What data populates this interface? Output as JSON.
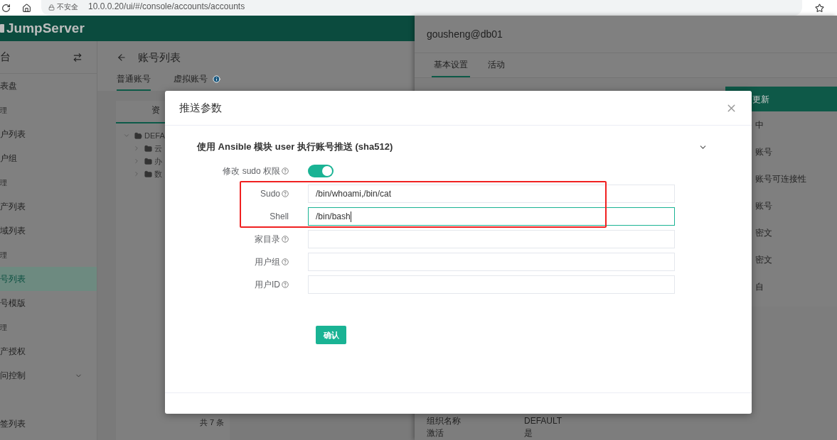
{
  "browser": {
    "security_label": "不安全",
    "url": "10.0.0.20/ui/#/console/accounts/accounts"
  },
  "header": {
    "logo": "JumpServer"
  },
  "sidebar": {
    "title": "台",
    "items": [
      {
        "label": "表盘",
        "kind": "item",
        "selected": false
      },
      {
        "label": "理",
        "kind": "group"
      },
      {
        "label": "户列表",
        "kind": "item",
        "selected": false
      },
      {
        "label": "户组",
        "kind": "item",
        "selected": false
      },
      {
        "label": "理",
        "kind": "group"
      },
      {
        "label": "产列表",
        "kind": "item",
        "selected": false
      },
      {
        "label": "域列表",
        "kind": "item",
        "selected": false
      },
      {
        "label": "理",
        "kind": "group"
      },
      {
        "label": "号列表",
        "kind": "item",
        "selected": true
      },
      {
        "label": "号模版",
        "kind": "item",
        "selected": false
      },
      {
        "label": "理",
        "kind": "group"
      },
      {
        "label": "产授权",
        "kind": "item",
        "selected": false
      },
      {
        "label": "问控制",
        "kind": "submenu",
        "selected": false,
        "expanded": false
      },
      {
        "label": "签列表",
        "kind": "item",
        "selected": false
      }
    ]
  },
  "page": {
    "title": "账号列表",
    "tabs": [
      {
        "label": "普通账号",
        "selected": true,
        "info": false
      },
      {
        "label": "虚拟账号",
        "selected": false,
        "info": true
      }
    ],
    "tree": {
      "tab": "资",
      "root": {
        "label": "DEFA",
        "expanded": true,
        "children": [
          {
            "label": "云",
            "expanded": false
          },
          {
            "label": "办",
            "expanded": false
          },
          {
            "label": "数",
            "expanded": false
          }
        ]
      }
    },
    "footer": "共 7 条"
  },
  "drawer": {
    "title": "gousheng@db01",
    "tabs": [
      {
        "label": "基本设置",
        "selected": true
      },
      {
        "label": "活动",
        "selected": false
      }
    ],
    "card": {
      "header": "更新",
      "items": [
        "中",
        "账号",
        "账号可连接性",
        "账号",
        "密文",
        "密文",
        "自"
      ]
    },
    "details": [
      {
        "label": "组织名称",
        "value": "DEFAULT"
      },
      {
        "label": "激活",
        "value": "是"
      }
    ]
  },
  "modal": {
    "title": "推送参数",
    "section": {
      "title": "使用 Ansible 模块 user 执行账号推送 (sha512)",
      "expanded": true
    },
    "fields": [
      {
        "label": "修改 sudo 权限",
        "help": true,
        "kind": "switch",
        "on": true,
        "highlighted": false
      },
      {
        "label": "Sudo",
        "help": true,
        "kind": "text",
        "value": "/bin/whoami,/bin/cat",
        "focused": false,
        "highlighted": true
      },
      {
        "label": "Shell",
        "help": false,
        "kind": "text",
        "value": "/bin/bash",
        "focused": true,
        "highlighted": true
      },
      {
        "label": "家目录",
        "help": true,
        "kind": "text",
        "focused": false,
        "highlighted": false
      },
      {
        "label": "用户组",
        "help": true,
        "kind": "text",
        "focused": false,
        "highlighted": false
      },
      {
        "label": "用户ID",
        "help": true,
        "kind": "text",
        "focused": false,
        "highlighted": false
      }
    ],
    "submit": "确认"
  }
}
